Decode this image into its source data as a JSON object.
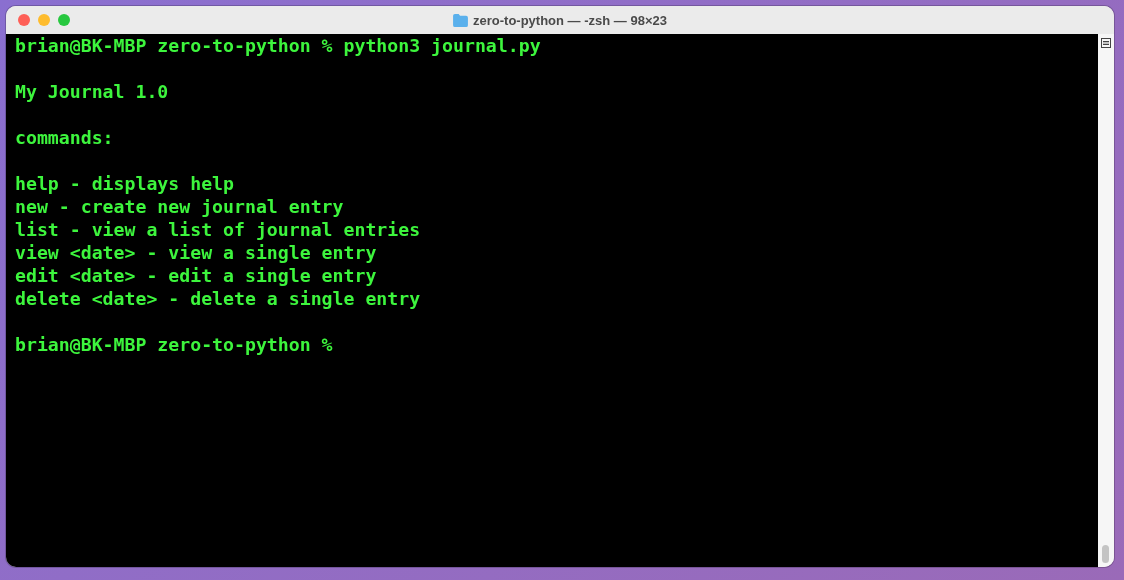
{
  "window": {
    "title": "zero-to-python — -zsh — 98×23"
  },
  "terminal": {
    "blocks": [
      [
        "brian@BK-MBP zero-to-python % python3 journal.py"
      ],
      [
        "My Journal 1.0"
      ],
      [
        "commands:"
      ],
      [
        "help - displays help",
        "new - create new journal entry",
        "list - view a list of journal entries",
        "view <date> - view a single entry",
        "edit <date> - edit a single entry",
        "delete <date> - delete a single entry"
      ],
      [
        "brian@BK-MBP zero-to-python %"
      ]
    ]
  }
}
